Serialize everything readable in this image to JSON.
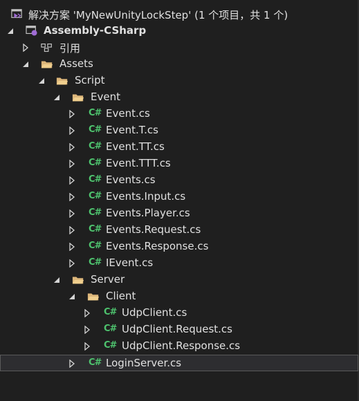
{
  "tree": {
    "solution": "解决方案 'MyNewUnityLockStep' (1 个项目，共 1 个)",
    "project": "Assembly-CSharp",
    "references": "引用",
    "assets": "Assets",
    "script": "Script",
    "event_folder": "Event",
    "event_files": [
      "Event.cs",
      "Event.T.cs",
      "Event.TT.cs",
      "Event.TTT.cs",
      "Events.cs",
      "Events.Input.cs",
      "Events.Player.cs",
      "Events.Request.cs",
      "Events.Response.cs",
      "IEvent.cs"
    ],
    "server_folder": "Server",
    "client_folder": "Client",
    "client_files": [
      "UdpClient.cs",
      "UdpClient.Request.cs",
      "UdpClient.Response.cs"
    ],
    "login_server": "LoginServer.cs",
    "cs_icon": "C#"
  },
  "colors": {
    "background": "#1f1f1f",
    "folder": "#dcb67a",
    "csharp_icon": "#4ec36e",
    "solution_icon": "#a06cd5"
  }
}
